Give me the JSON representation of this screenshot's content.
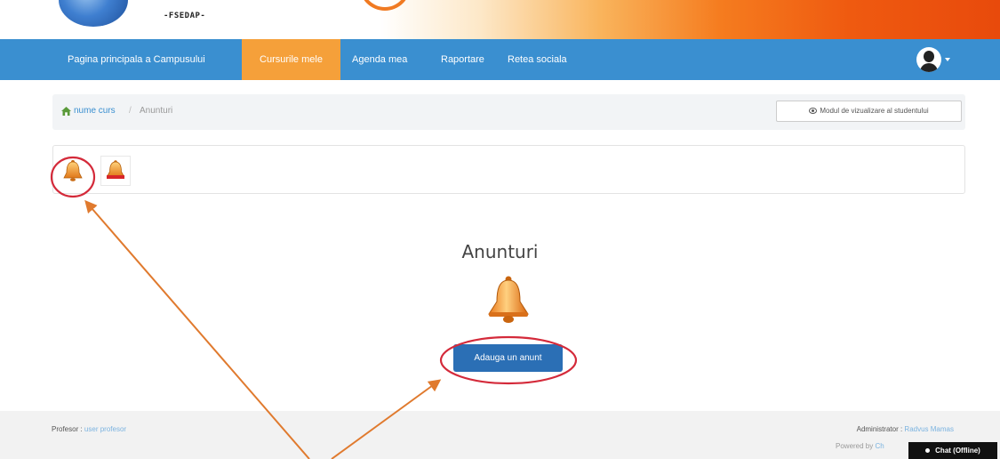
{
  "banner": {
    "logo_text": "-FSEDAP-"
  },
  "navbar": {
    "items": [
      {
        "label": "Pagina principala a Campusului",
        "active": false
      },
      {
        "label": "Cursurile mele",
        "active": true
      },
      {
        "label": "Agenda mea",
        "active": false
      },
      {
        "label": "Raportare",
        "active": false
      },
      {
        "label": "Retea sociala",
        "active": false
      }
    ],
    "avatar_icon": "user-avatar-icon"
  },
  "breadcrumb": {
    "home_icon": "home-icon",
    "course": "nume curs",
    "separator": "/",
    "current": "Anunturi",
    "student_view_label": "Modul de vizualizare al studentului"
  },
  "toolbar": {
    "announcements_icon": "bell-icon",
    "add_announcement_icon": "bell-add-icon"
  },
  "main": {
    "title": "Anunturi",
    "add_button_label": "Adauga un anunt"
  },
  "footer": {
    "professor_label": "Profesor :",
    "professor_name": "user profesor",
    "admin_label": "Administrator :",
    "admin_name": "Radvus Mamas",
    "powered_label": "Powered by",
    "powered_name": "Ch"
  },
  "chat": {
    "label": "Chat (Offline)"
  },
  "colors": {
    "nav_bg": "#3a8fd0",
    "nav_active": "#f5a03a",
    "primary_button": "#2b6fb5",
    "annotation_circle": "#d42a3a",
    "annotation_arrow": "#e07a2e"
  }
}
